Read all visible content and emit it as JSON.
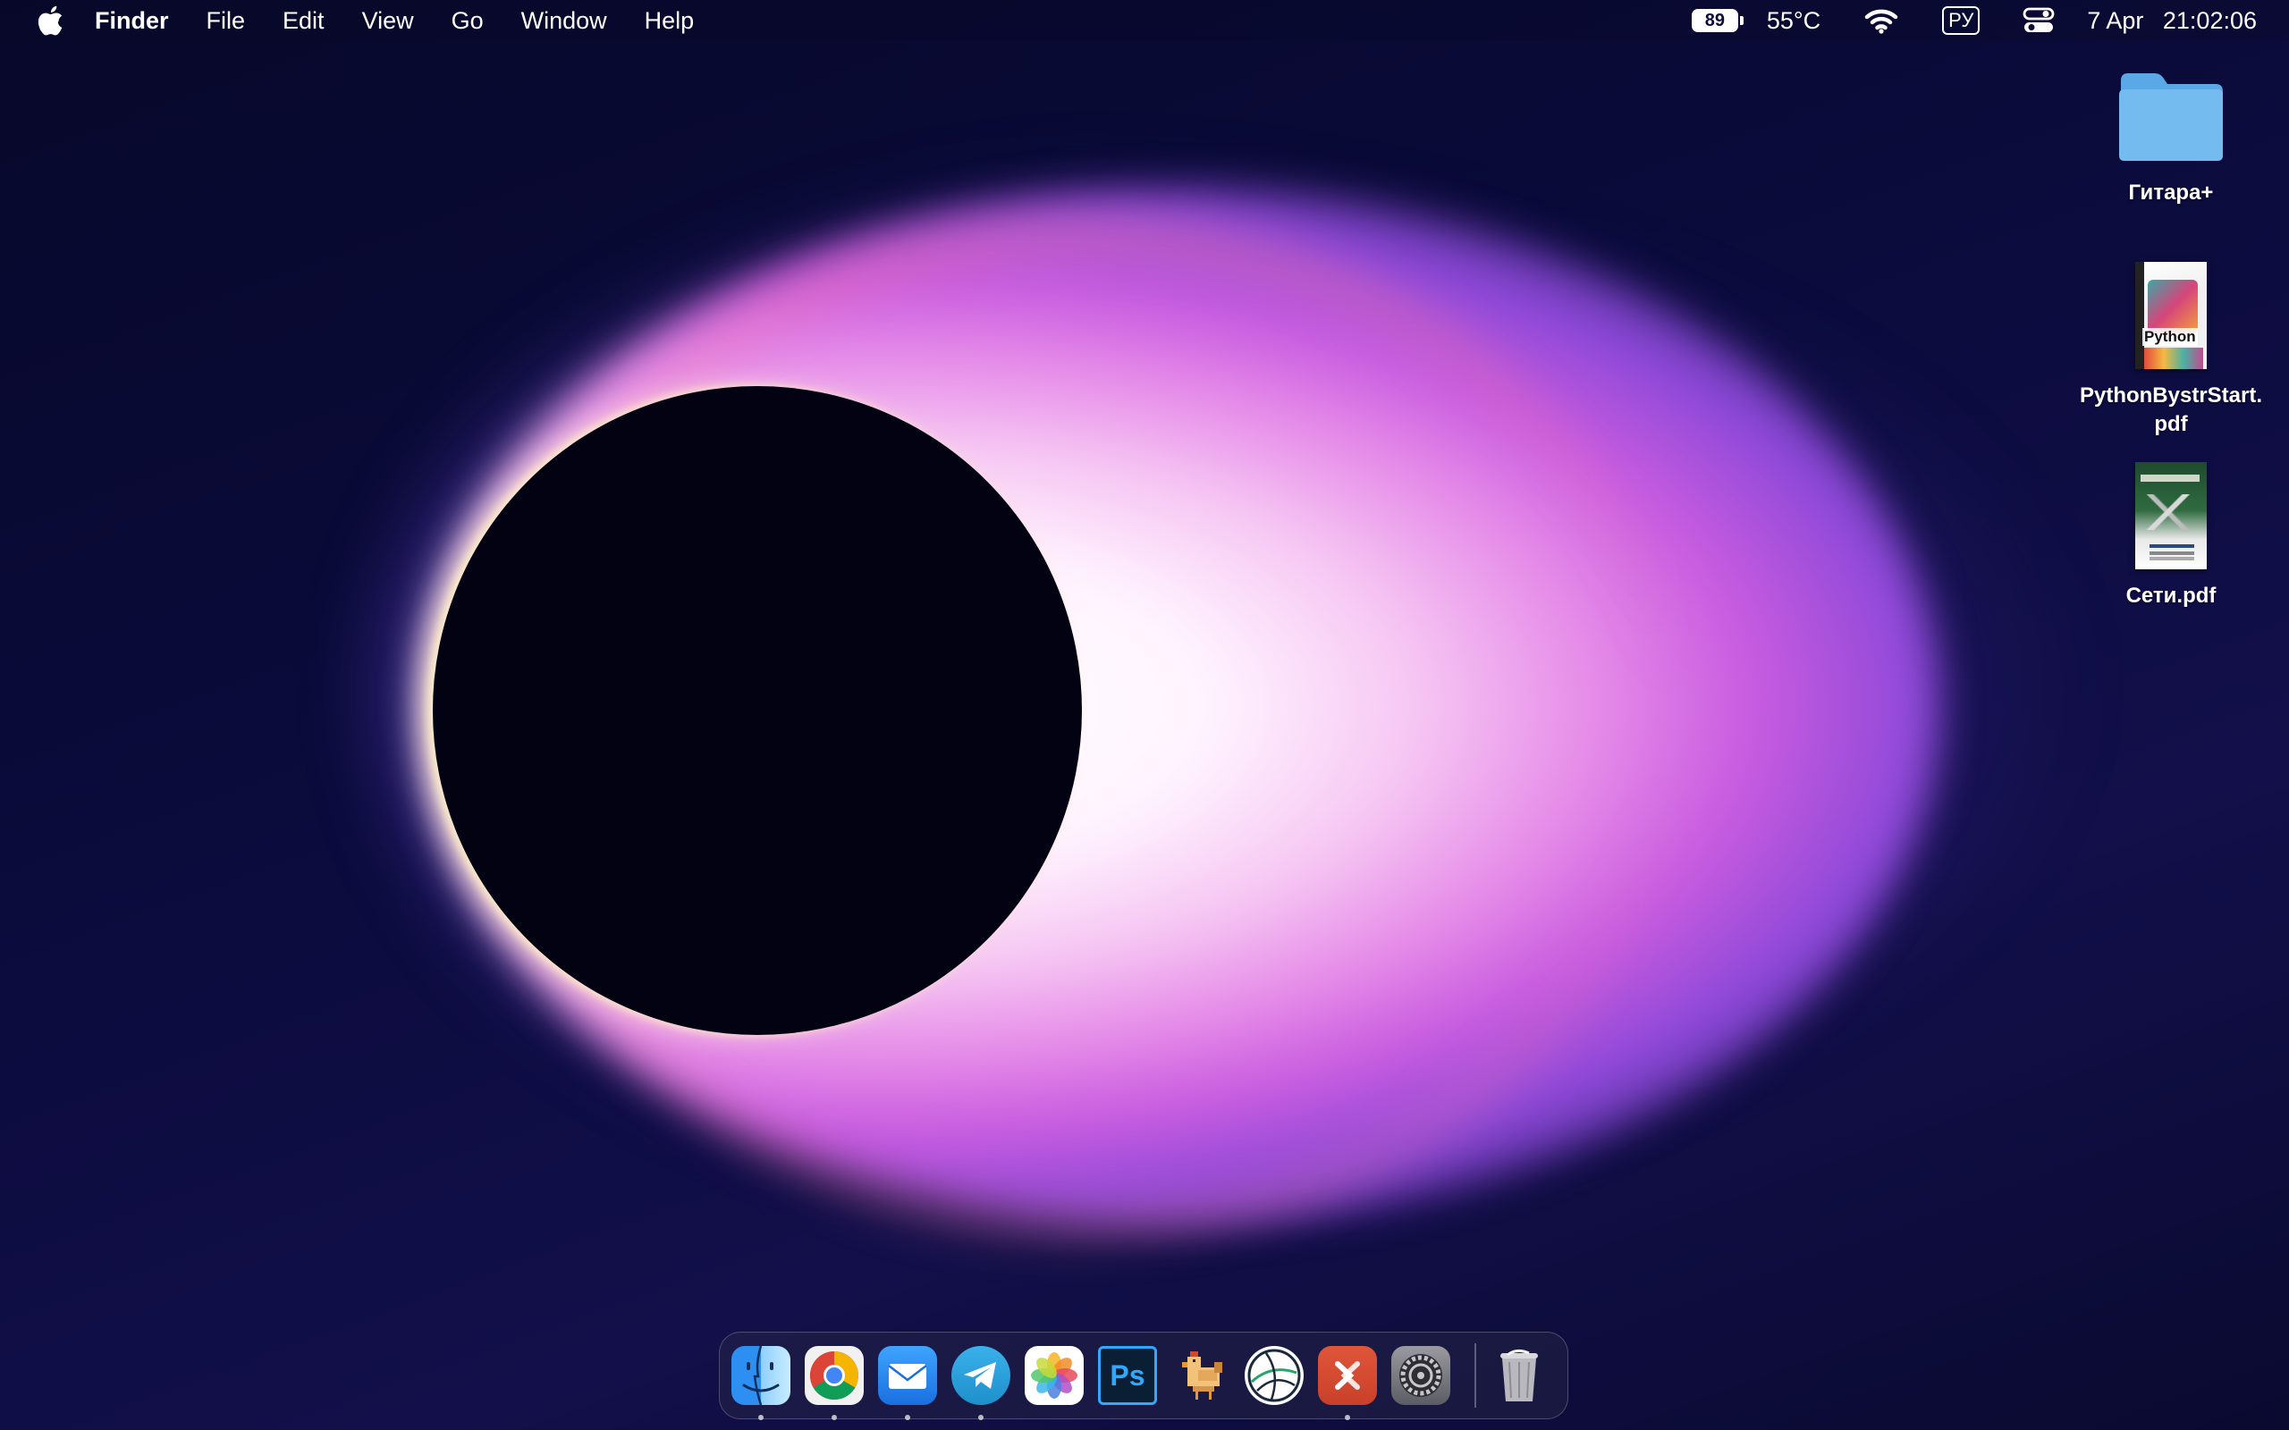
{
  "menubar": {
    "apple_icon": "apple-logo-icon",
    "app_name": "Finder",
    "items": [
      "File",
      "Edit",
      "View",
      "Go",
      "Window",
      "Help"
    ],
    "battery_percent": "89",
    "temperature": "55°C",
    "input_language": "РУ",
    "date": "7 Apr",
    "time": "21:02:06"
  },
  "desktop_icons": [
    {
      "label": "Гитара+",
      "type": "folder"
    },
    {
      "label": "PythonBystrStart.\npdf",
      "type": "pdf"
    },
    {
      "label": "Сети.pdf",
      "type": "pdf"
    }
  ],
  "dock": {
    "apps": [
      {
        "name": "Finder",
        "icon": "finder-icon",
        "running": true
      },
      {
        "name": "Google Chrome",
        "icon": "chrome-icon",
        "running": true
      },
      {
        "name": "Mail",
        "icon": "mail-icon",
        "running": true
      },
      {
        "name": "Telegram",
        "icon": "telegram-icon",
        "running": true
      },
      {
        "name": "Photos",
        "icon": "photos-icon",
        "running": false
      },
      {
        "name": "Photoshop",
        "icon": "photoshop-icon",
        "running": false,
        "label": "Ps"
      },
      {
        "name": "Stardew-like game",
        "icon": "chicken-pixel-icon",
        "running": false
      },
      {
        "name": "Network app",
        "icon": "globe-icon",
        "running": false
      },
      {
        "name": "Remote Desktop",
        "icon": "remote-desktop-icon",
        "running": true
      },
      {
        "name": "System Settings",
        "icon": "settings-gear-icon",
        "running": false
      }
    ],
    "trash": {
      "name": "Trash",
      "icon": "trash-icon"
    }
  },
  "colors": {
    "menubar_text": "#ffffff",
    "background_dark": "#0b0b3c",
    "glow_pink": "#e58ae8",
    "glow_purple": "#8b48d8"
  }
}
